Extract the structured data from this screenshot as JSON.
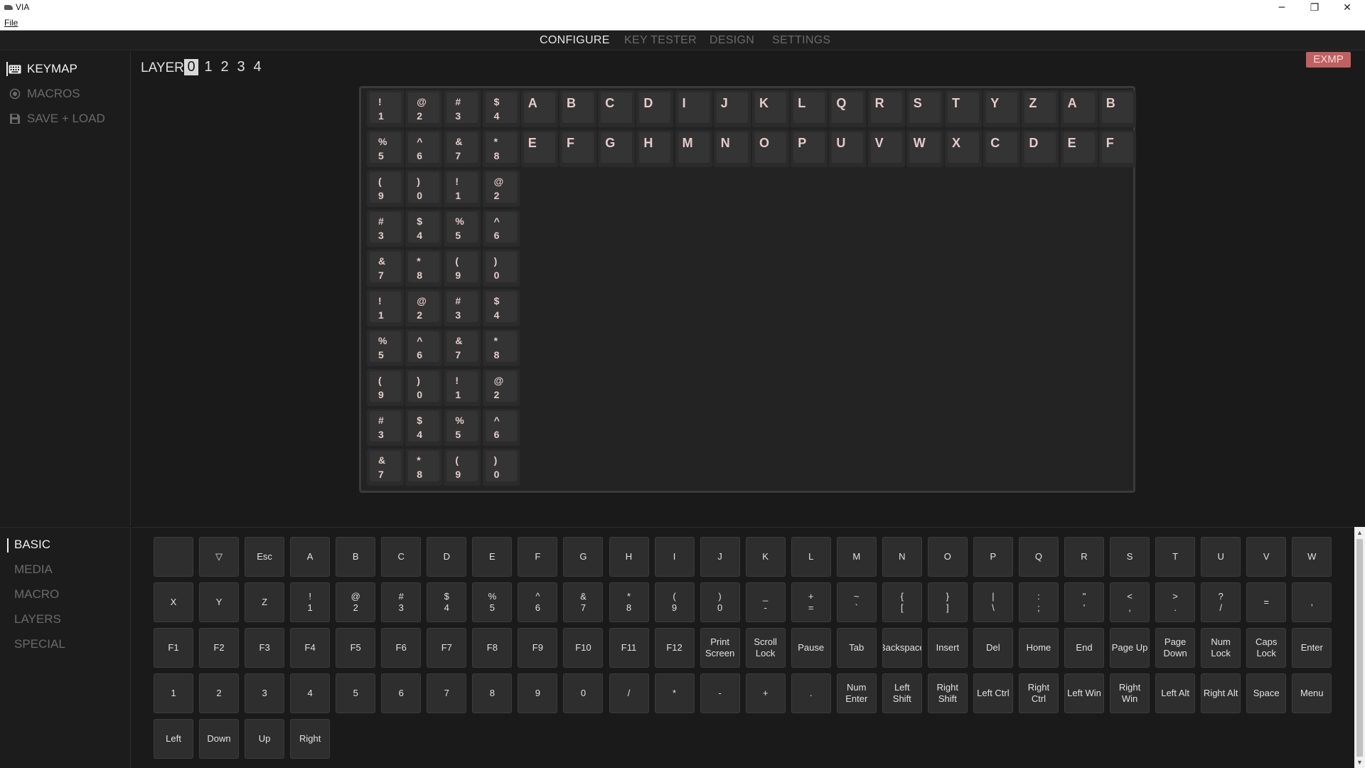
{
  "window": {
    "title": "VIA",
    "menu_file": "File",
    "controls": {
      "minimize": "─",
      "restore": "❐",
      "close": "✕"
    }
  },
  "nav": {
    "tabs": [
      {
        "label": "CONFIGURE",
        "active": true
      },
      {
        "label": "KEY TESTER",
        "active": false
      },
      {
        "label": "DESIGN",
        "active": false
      },
      {
        "label": "SETTINGS",
        "active": false
      }
    ]
  },
  "sidebar_top": {
    "items": [
      {
        "label": "KEYMAP",
        "icon": "keyboard-icon",
        "active": true
      },
      {
        "label": "MACROS",
        "icon": "macro-icon",
        "active": false
      },
      {
        "label": "SAVE + LOAD",
        "icon": "save-icon",
        "active": false
      }
    ]
  },
  "layers": {
    "label": "LAYER",
    "numbers": [
      "0",
      "1",
      "2",
      "3",
      "4"
    ],
    "active": "0"
  },
  "keyboard_badge": "EXMP",
  "keymap": {
    "row1": [
      [
        "!",
        "1"
      ],
      [
        "@",
        "2"
      ],
      [
        "#",
        "3"
      ],
      [
        "$",
        "4"
      ],
      "A",
      "B",
      "C",
      "D",
      "I",
      "J",
      "K",
      "L",
      "Q",
      "R",
      "S",
      "T",
      "Y",
      "Z",
      "A",
      "B"
    ],
    "row2": [
      [
        "%",
        "5"
      ],
      [
        "^",
        "6"
      ],
      [
        "&",
        "7"
      ],
      [
        "*",
        "8"
      ],
      "E",
      "F",
      "G",
      "H",
      "M",
      "N",
      "O",
      "P",
      "U",
      "V",
      "W",
      "X",
      "C",
      "D",
      "E",
      "F"
    ],
    "column": [
      [
        [
          "(",
          "9"
        ],
        [
          ")",
          "0"
        ],
        [
          "!",
          "1"
        ],
        [
          "@",
          "2"
        ]
      ],
      [
        [
          "#",
          "3"
        ],
        [
          "$",
          "4"
        ],
        [
          "%",
          "5"
        ],
        [
          "^",
          "6"
        ]
      ],
      [
        [
          "&",
          "7"
        ],
        [
          "*",
          "8"
        ],
        [
          "(",
          "9"
        ],
        [
          ")",
          "0"
        ]
      ],
      [
        [
          "!",
          "1"
        ],
        [
          "@",
          "2"
        ],
        [
          "#",
          "3"
        ],
        [
          "$",
          "4"
        ]
      ],
      [
        [
          "%",
          "5"
        ],
        [
          "^",
          "6"
        ],
        [
          "&",
          "7"
        ],
        [
          "*",
          "8"
        ]
      ],
      [
        [
          "(",
          "9"
        ],
        [
          ")",
          "0"
        ],
        [
          "!",
          "1"
        ],
        [
          "@",
          "2"
        ]
      ],
      [
        [
          "#",
          "3"
        ],
        [
          "$",
          "4"
        ],
        [
          "%",
          "5"
        ],
        [
          "^",
          "6"
        ]
      ],
      [
        [
          "&",
          "7"
        ],
        [
          "*",
          "8"
        ],
        [
          "(",
          "9"
        ],
        [
          ")",
          "0"
        ]
      ]
    ]
  },
  "sidebar_bottom": {
    "items": [
      {
        "label": "BASIC",
        "active": true
      },
      {
        "label": "MEDIA",
        "active": false
      },
      {
        "label": "MACRO",
        "active": false
      },
      {
        "label": "LAYERS",
        "active": false
      },
      {
        "label": "SPECIAL",
        "active": false
      }
    ]
  },
  "palette": {
    "rows": [
      [
        "",
        "▽",
        "Esc",
        "A",
        "B",
        "C",
        "D",
        "E",
        "F",
        "G",
        "H",
        "I",
        "J",
        "K",
        "L",
        "M",
        "N",
        "O",
        "P",
        "Q",
        "R",
        "S",
        "T",
        "U",
        "V",
        "W"
      ],
      [
        "X",
        "Y",
        "Z",
        "!\n1",
        "@\n2",
        "#\n3",
        "$\n4",
        "%\n5",
        "^\n6",
        "&\n7",
        "*\n8",
        "(\n9",
        ")\n0",
        "_\n-",
        "+\n=",
        "~\n`",
        "{\n[",
        "}\n]",
        "|\n\\",
        ":\n;",
        "\"\n'",
        "<\n,",
        ">\n.",
        "?\n/",
        "=",
        ","
      ],
      [
        "F1",
        "F2",
        "F3",
        "F4",
        "F5",
        "F6",
        "F7",
        "F8",
        "F9",
        "F10",
        "F11",
        "F12",
        "Print\nScreen",
        "Scroll\nLock",
        "Pause",
        "Tab",
        "Backspace",
        "Insert",
        "Del",
        "Home",
        "End",
        "Page Up",
        "Page\nDown",
        "Num\nLock",
        "Caps\nLock",
        "Enter"
      ],
      [
        "1",
        "2",
        "3",
        "4",
        "5",
        "6",
        "7",
        "8",
        "9",
        "0",
        "/",
        "*",
        "-",
        "+",
        ".",
        "Num\nEnter",
        "Left\nShift",
        "Right\nShift",
        "Left Ctrl",
        "Right\nCtrl",
        "Left Win",
        "Right\nWin",
        "Left Alt",
        "Right Alt",
        "Space",
        "Menu"
      ],
      [
        "Left",
        "Down",
        "Up",
        "Right"
      ]
    ]
  },
  "scrollbar": {
    "up": "▲",
    "down": "▼"
  }
}
